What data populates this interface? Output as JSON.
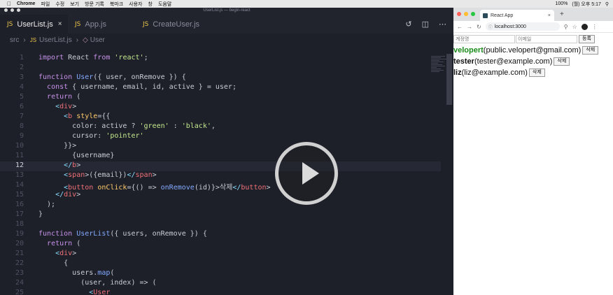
{
  "menubar": {
    "apple": "",
    "app": "Chrome",
    "items": [
      "파일",
      "수정",
      "보기",
      "방문 기록",
      "북마크",
      "사용자",
      "창",
      "도움말"
    ],
    "status": [
      "100%",
      "(월) 오후 5:17"
    ]
  },
  "editor": {
    "window_title": "UserList.js — begin-react",
    "tabs": [
      {
        "label": "UserList.js",
        "icon": "JS",
        "active": true,
        "close": "×"
      },
      {
        "label": "App.js",
        "icon": "JS",
        "active": false
      },
      {
        "label": "CreateUser.js",
        "icon": "JS",
        "active": false
      }
    ],
    "breadcrumb": {
      "folder": "src",
      "file": "UserList.js",
      "symbol": "User"
    },
    "current_line": 12,
    "lines": [
      {
        "n": "1",
        "code": "import React from 'react';"
      },
      {
        "n": "2",
        "code": ""
      },
      {
        "n": "3",
        "code": "function User({ user, onRemove }) {"
      },
      {
        "n": "4",
        "code": "  const { username, email, id, active } = user;"
      },
      {
        "n": "5",
        "code": "  return ("
      },
      {
        "n": "6",
        "code": "    <div>"
      },
      {
        "n": "7",
        "code": "      <b style={{"
      },
      {
        "n": "8",
        "code": "        color: active ? 'green' : 'black',"
      },
      {
        "n": "9",
        "code": "        cursor: 'pointer'"
      },
      {
        "n": "10",
        "code": "      }}>"
      },
      {
        "n": "11",
        "code": "        {username}"
      },
      {
        "n": "12",
        "code": "      </b>"
      },
      {
        "n": "13",
        "code": "      <span>({email})</span>"
      },
      {
        "n": "14",
        "code": "      <button onClick={() => onRemove(id)}>삭제</button>"
      },
      {
        "n": "15",
        "code": "    </div>"
      },
      {
        "n": "16",
        "code": "  );"
      },
      {
        "n": "17",
        "code": "}"
      },
      {
        "n": "18",
        "code": ""
      },
      {
        "n": "19",
        "code": "function UserList({ users, onRemove }) {"
      },
      {
        "n": "20",
        "code": "  return ("
      },
      {
        "n": "21",
        "code": "    <div>"
      },
      {
        "n": "22",
        "code": "      {"
      },
      {
        "n": "23",
        "code": "        users.map("
      },
      {
        "n": "24",
        "code": "          (user, index) => ("
      },
      {
        "n": "25",
        "code": "            <User"
      }
    ]
  },
  "browser": {
    "tab_title": "React App",
    "tab_close": "×",
    "new_tab": "+",
    "url": "localhost:3000",
    "form": {
      "username_placeholder": "계정명",
      "email_placeholder": "이메일",
      "submit_label": "등록"
    },
    "users": [
      {
        "username": "velopert",
        "email": "(public.velopert@gmail.com)",
        "active": true,
        "remove_label": "삭제"
      },
      {
        "username": "tester",
        "email": "(tester@example.com)",
        "active": false,
        "remove_label": "삭제"
      },
      {
        "username": "liz",
        "email": "(liz@example.com)",
        "active": false,
        "remove_label": "삭제"
      }
    ]
  },
  "colors": {
    "active_user": "#1a8a1a",
    "editor_bg": "#1e2029"
  }
}
